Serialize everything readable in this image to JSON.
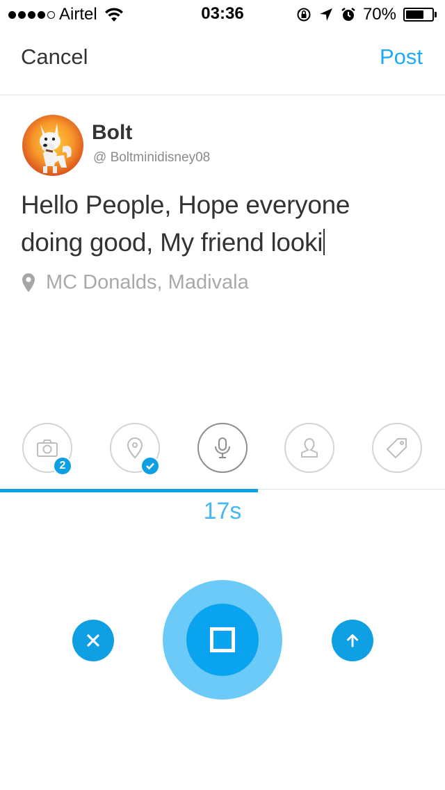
{
  "status_bar": {
    "carrier": "Airtel",
    "time": "03:36",
    "battery_percent": "70%",
    "battery_level": 0.7,
    "signal_bars": 4,
    "signal_total": 5
  },
  "nav": {
    "cancel_label": "Cancel",
    "post_label": "Post"
  },
  "user": {
    "name": "Bolt",
    "handle": "@ Boltminidisney08"
  },
  "message": {
    "text": "Hello People, Hope everyone doing good, My friend looki"
  },
  "location": {
    "text": "MC Donalds, Madivala"
  },
  "toolbar": {
    "items": [
      {
        "name": "camera",
        "icon": "camera-icon",
        "badge": "2"
      },
      {
        "name": "location",
        "icon": "location-pin-icon",
        "badge": "check"
      },
      {
        "name": "microphone",
        "icon": "microphone-icon",
        "active": true
      },
      {
        "name": "people",
        "icon": "person-icon"
      },
      {
        "name": "tag",
        "icon": "tag-icon"
      }
    ]
  },
  "recording": {
    "elapsed": "17s",
    "progress": 0.58
  },
  "colors": {
    "accent": "#1eaaf1",
    "button_blue": "#0f9fe3",
    "record_outer": "#6ccaf8",
    "muted_text": "#a9a9a9"
  }
}
